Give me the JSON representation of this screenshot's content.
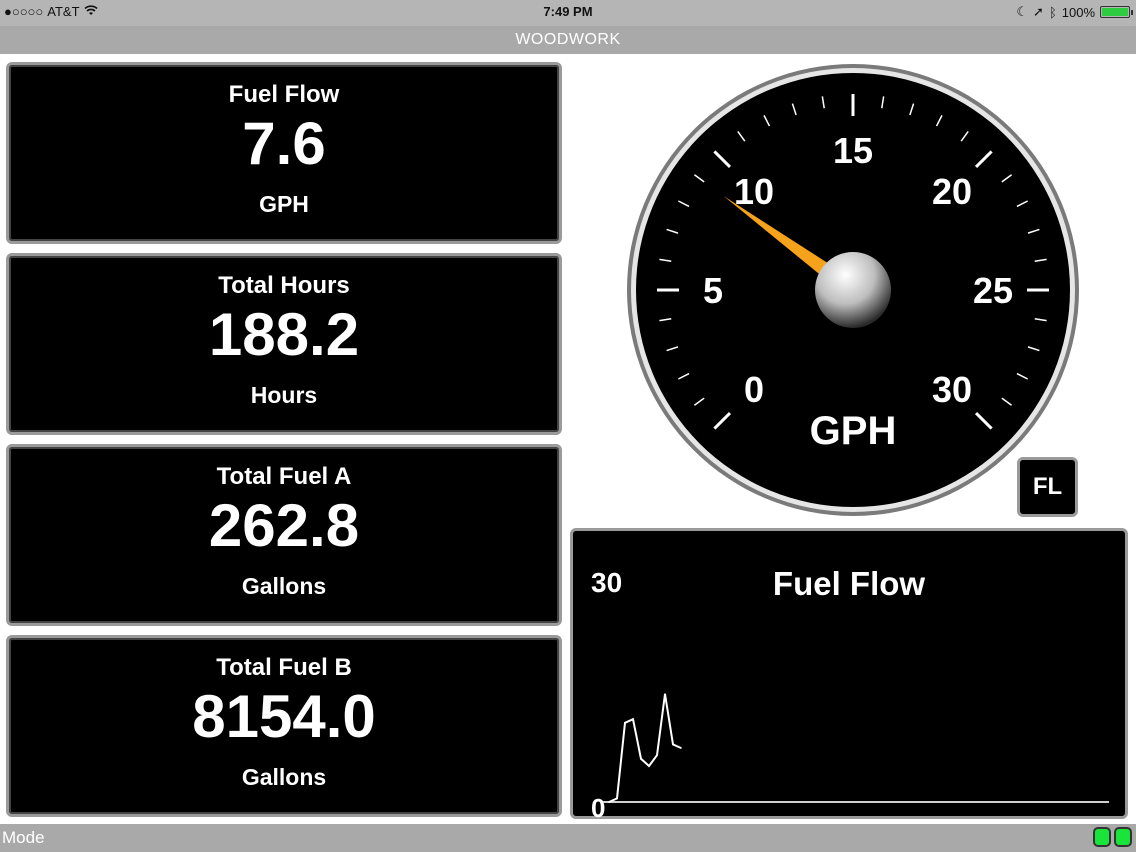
{
  "status_bar": {
    "signal": "●○○○○",
    "carrier": "AT&T",
    "time": "7:49 PM",
    "battery": "100%"
  },
  "title": "WOODWORK",
  "tiles": [
    {
      "label": "Fuel Flow",
      "value": "7.6",
      "unit": "GPH"
    },
    {
      "label": "Total Hours",
      "value": "188.2",
      "unit": "Hours"
    },
    {
      "label": "Total Fuel A",
      "value": "262.8",
      "unit": "Gallons"
    },
    {
      "label": "Total Fuel B",
      "value": "8154.0",
      "unit": "Gallons"
    }
  ],
  "gauge": {
    "min": 0,
    "max": 30,
    "reading": 9.0,
    "unit": "GPH",
    "labels": [
      "0",
      "5",
      "10",
      "15",
      "20",
      "25",
      "30"
    ],
    "needle_color": "#f7a21b"
  },
  "fl_button": "FL",
  "graph": {
    "title": "Fuel Flow",
    "max_label": "30",
    "min_label": "0"
  },
  "chart_data": {
    "type": "line",
    "title": "Fuel Flow",
    "ylim": [
      0,
      30
    ],
    "series": [
      {
        "values": [
          0,
          0.5,
          11.0,
          11.5,
          6.0,
          5.0,
          6.5,
          15.0,
          8.0,
          7.5
        ]
      }
    ]
  },
  "bottom_bar": {
    "mode": "Mode",
    "indicator_color": "#19e43a"
  }
}
